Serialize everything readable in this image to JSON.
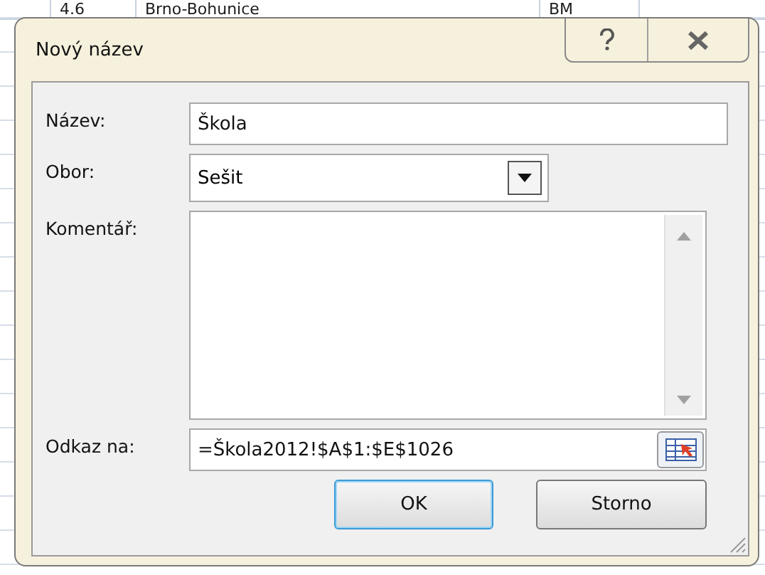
{
  "sheet_row": [
    "4.6",
    "Brno-Bohunice",
    "BM"
  ],
  "dialog": {
    "title": "Nový název",
    "fields": [
      {
        "kind": "text",
        "label": "Název:",
        "value": "Škola"
      },
      {
        "kind": "combo",
        "label": "Obor:",
        "value": "Sešit"
      },
      {
        "kind": "textarea",
        "label": "Komentář:"
      },
      {
        "kind": "reference",
        "label": "Odkaz na:",
        "value": "=Škola2012!$A$1:$E$1026"
      }
    ],
    "buttons": [
      {
        "label": "OK",
        "default": true
      },
      {
        "label": "Storno",
        "default": false
      }
    ]
  }
}
